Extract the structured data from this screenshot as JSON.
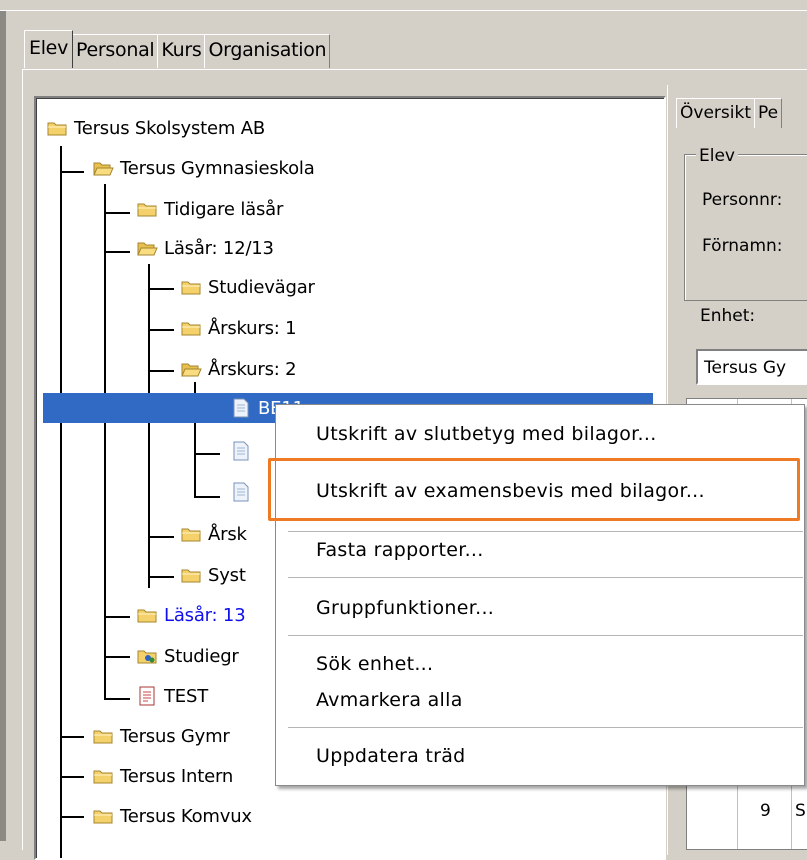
{
  "main_tabs": [
    "Elev",
    "Personal",
    "Kurs",
    "Organisation"
  ],
  "tree": {
    "root": "Tersus Skolsystem AB",
    "school1": "Tersus Gymnasieskola",
    "tidigare": "Tidigare läsår",
    "lasar1213": "Läsår: 12/13",
    "studievagar": "Studievägar",
    "arskurs1": "Årskurs: 1",
    "arskurs2": "Årskurs: 2",
    "selected_class": "BE11",
    "arsk_trunc": "Årsk",
    "syst_trunc": "Syst",
    "lasar13_trunc": "Läsår: 13",
    "studiegr_trunc": "Studiegr",
    "test": "TEST",
    "school2_trunc": "Tersus Gymr",
    "school3_trunc": "Tersus Intern",
    "komvux": "Tersus Komvux"
  },
  "right_panel": {
    "tabs": [
      "Översikt",
      "Pe"
    ],
    "group_title": "Elev",
    "personnr_label": "Personnr:",
    "fornamn_label": "Förnamn:",
    "enhet_label": "Enhet:",
    "enhet_value": "Tersus Gy",
    "grid_number": "9",
    "grid_letter": "S"
  },
  "context_menu": {
    "items": [
      "Utskrift av slutbetyg med bilagor...",
      "Utskrift av examensbevis med bilagor...",
      "Fasta rapporter...",
      "Gruppfunktioner...",
      "Sök enhet...",
      "Avmarkera alla",
      "Uppdatera träd"
    ],
    "highlighted_item_index": 1,
    "highlight_color": "#ee7a23"
  },
  "colors": {
    "selection": "#316ac5",
    "folder": "#f5d16b",
    "link_blue": "#1010ee"
  },
  "icons": [
    "folder-icon",
    "document-icon",
    "group-folder-icon",
    "report-icon"
  ]
}
